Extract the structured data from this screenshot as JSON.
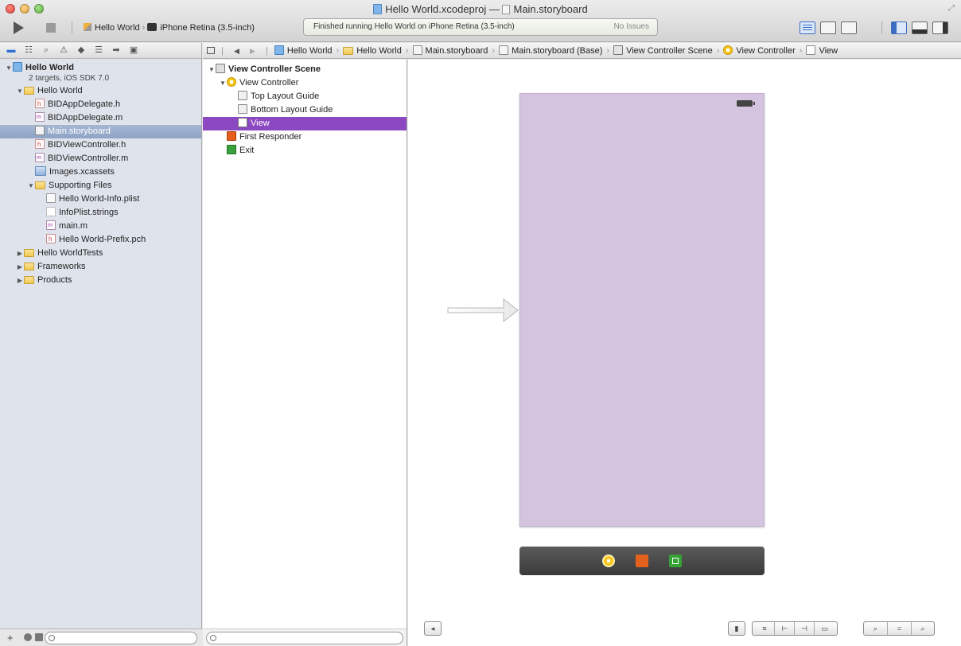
{
  "window": {
    "project_title": "Hello World.xcodeproj",
    "title_separator": "—",
    "file_title": "Main.storyboard"
  },
  "toolbar": {
    "scheme_name": "Hello World",
    "device_name": "iPhone Retina (3.5-inch)",
    "status_message": "Finished running Hello World on iPhone Retina (3.5-inch)",
    "issues": "No Issues"
  },
  "navigator": {
    "project": {
      "name": "Hello World",
      "subtitle": "2 targets, iOS SDK 7.0"
    },
    "items": [
      {
        "label": "Hello World",
        "kind": "folder",
        "level": 1,
        "disclosure": "open"
      },
      {
        "label": "BIDAppDelegate.h",
        "kind": "h",
        "level": 2
      },
      {
        "label": "BIDAppDelegate.m",
        "kind": "m",
        "level": 2
      },
      {
        "label": "Main.storyboard",
        "kind": "sb",
        "level": 2,
        "selected": true
      },
      {
        "label": "BIDViewController.h",
        "kind": "h",
        "level": 2
      },
      {
        "label": "BIDViewController.m",
        "kind": "m",
        "level": 2
      },
      {
        "label": "Images.xcassets",
        "kind": "assets",
        "level": 2
      },
      {
        "label": "Supporting Files",
        "kind": "folder",
        "level": 2,
        "disclosure": "open"
      },
      {
        "label": "Hello World-Info.plist",
        "kind": "plist",
        "level": 3
      },
      {
        "label": "InfoPlist.strings",
        "kind": "strings",
        "level": 3
      },
      {
        "label": "main.m",
        "kind": "m",
        "level": 3
      },
      {
        "label": "Hello World-Prefix.pch",
        "kind": "h",
        "level": 3
      },
      {
        "label": "Hello WorldTests",
        "kind": "folder",
        "level": 1,
        "disclosure": "closed"
      },
      {
        "label": "Frameworks",
        "kind": "folder",
        "level": 1,
        "disclosure": "closed"
      },
      {
        "label": "Products",
        "kind": "folder",
        "level": 1,
        "disclosure": "closed"
      }
    ],
    "add_label": "+"
  },
  "jumpbar": {
    "crumbs": [
      {
        "label": "Hello World",
        "kind": "proj"
      },
      {
        "label": "Hello World",
        "kind": "folder"
      },
      {
        "label": "Main.storyboard",
        "kind": "sb"
      },
      {
        "label": "Main.storyboard (Base)",
        "kind": "sb"
      },
      {
        "label": "View Controller Scene",
        "kind": "scene"
      },
      {
        "label": "View Controller",
        "kind": "vc"
      },
      {
        "label": "View",
        "kind": "view"
      }
    ]
  },
  "outline": {
    "items": [
      {
        "label": "View Controller Scene",
        "kind": "scene",
        "level": 0,
        "disclosure": "open",
        "bold": true
      },
      {
        "label": "View Controller",
        "kind": "vc",
        "level": 1,
        "disclosure": "open"
      },
      {
        "label": "Top Layout Guide",
        "kind": "guide",
        "level": 2
      },
      {
        "label": "Bottom Layout Guide",
        "kind": "guide",
        "level": 2
      },
      {
        "label": "View",
        "kind": "view",
        "level": 2,
        "selected": true
      },
      {
        "label": "First Responder",
        "kind": "fr",
        "level": 1
      },
      {
        "label": "Exit",
        "kind": "exit",
        "level": 1
      }
    ]
  },
  "colors": {
    "view_background": "#d4c4df",
    "outline_selection": "#8c48c0",
    "navigator_selection": "#8ea3c6"
  },
  "icons": {
    "navigator_tabs": [
      "project-navigator-icon",
      "symbol-navigator-icon",
      "find-navigator-icon",
      "issue-navigator-icon",
      "test-navigator-icon",
      "debug-navigator-icon",
      "breakpoint-navigator-icon",
      "log-navigator-icon"
    ]
  }
}
